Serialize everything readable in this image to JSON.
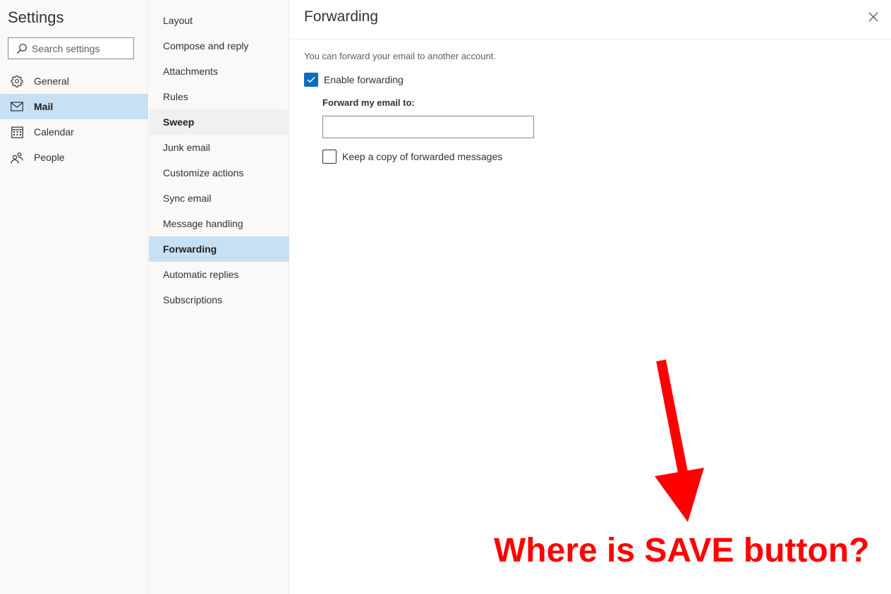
{
  "settings": {
    "title": "Settings",
    "search_placeholder": "Search settings",
    "categories": [
      {
        "label": "General",
        "icon": "gear-icon"
      },
      {
        "label": "Mail",
        "icon": "mail-icon",
        "selected": true
      },
      {
        "label": "Calendar",
        "icon": "calendar-icon"
      },
      {
        "label": "People",
        "icon": "people-icon"
      }
    ]
  },
  "mail_nav": {
    "items": [
      {
        "label": "Layout"
      },
      {
        "label": "Compose and reply"
      },
      {
        "label": "Attachments"
      },
      {
        "label": "Rules"
      },
      {
        "label": "Sweep",
        "hovered": true
      },
      {
        "label": "Junk email"
      },
      {
        "label": "Customize actions"
      },
      {
        "label": "Sync email"
      },
      {
        "label": "Message handling"
      },
      {
        "label": "Forwarding",
        "selected": true
      },
      {
        "label": "Automatic replies"
      },
      {
        "label": "Subscriptions"
      }
    ]
  },
  "forwarding": {
    "title": "Forwarding",
    "description": "You can forward your email to another account.",
    "enable_label": "Enable forwarding",
    "enable_checked": true,
    "forward_to_label": "Forward my email to:",
    "forward_to_value": "",
    "keep_copy_label": "Keep a copy of forwarded messages",
    "keep_copy_checked": false
  },
  "annotation": {
    "text": "Where is SAVE button?",
    "color": "#ff0000"
  },
  "colors": {
    "accent": "#0f6cbd",
    "selected_bg": "#c7e0f4",
    "sidebar_bg": "#faf9f8"
  }
}
